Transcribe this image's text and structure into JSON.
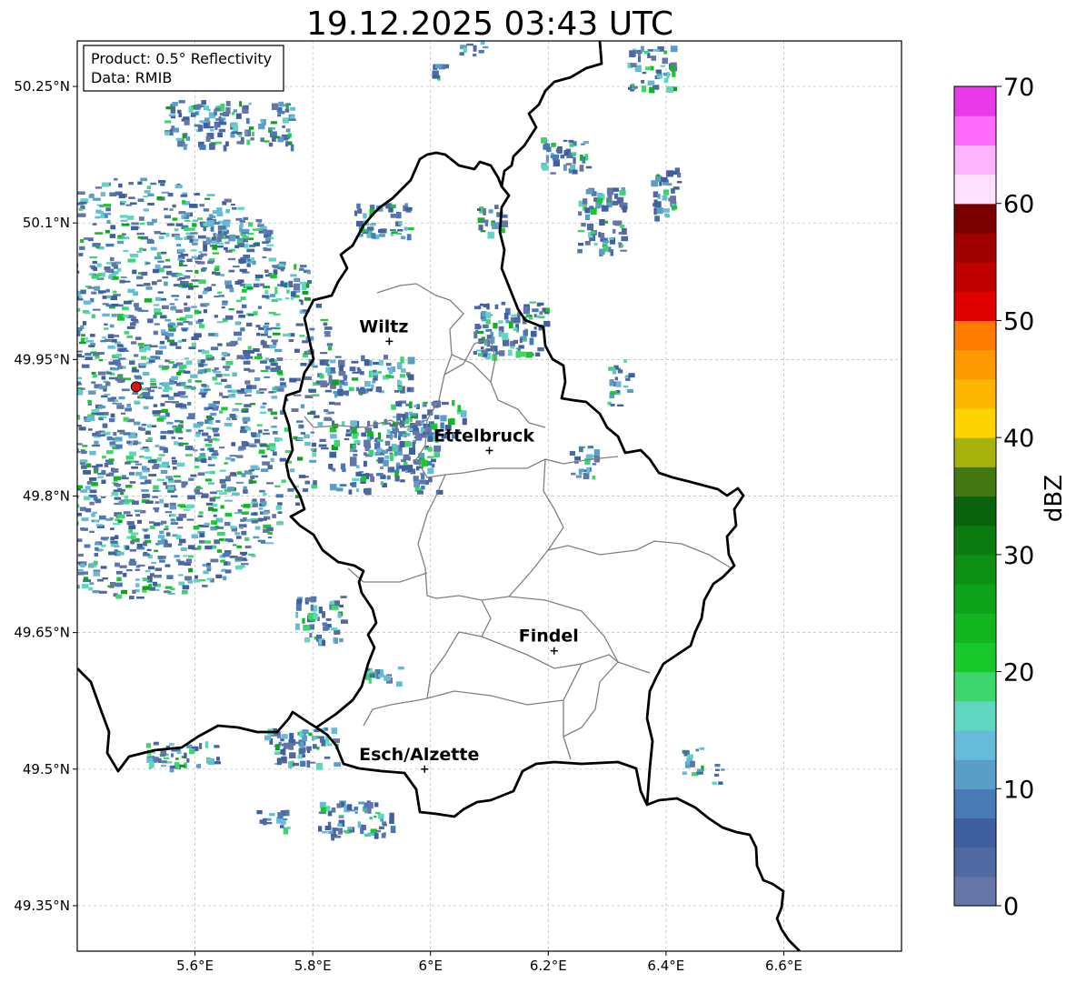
{
  "title": "19.12.2025 03:43 UTC",
  "info_box": {
    "product": "Product: 0.5° Reflectivity",
    "data": "Data: RMIB"
  },
  "axes": {
    "lon_ticks": [
      "5.6°E",
      "5.8°E",
      "6°E",
      "6.2°E",
      "6.4°E",
      "6.6°E"
    ],
    "lat_ticks": [
      "50.25°N",
      "50.1°N",
      "49.95°N",
      "49.8°N",
      "49.65°N",
      "49.5°N",
      "49.35°N"
    ],
    "lon_values": [
      5.6,
      5.8,
      6.0,
      6.2,
      6.4,
      6.6
    ],
    "lat_values": [
      50.25,
      50.1,
      49.95,
      49.8,
      49.65,
      49.5,
      49.35
    ],
    "lon_range": [
      5.4,
      6.8
    ],
    "lat_range": [
      49.3,
      50.3
    ],
    "grid": true
  },
  "cities": [
    {
      "name": "Wiltz",
      "lon": 5.93,
      "lat": 49.97
    },
    {
      "name": "Ettelbruck",
      "lon": 6.1,
      "lat": 49.85
    },
    {
      "name": "Findel",
      "lon": 6.21,
      "lat": 49.63
    },
    {
      "name": "Esch/Alzette",
      "lon": 5.99,
      "lat": 49.5
    }
  ],
  "radar_site": {
    "lon": 5.5,
    "lat": 49.92,
    "color": "#e01010"
  },
  "colorbar": {
    "label": "dBZ",
    "ticks": [
      "0",
      "10",
      "20",
      "30",
      "40",
      "50",
      "60",
      "70"
    ],
    "min": 0,
    "max": 70,
    "colors": [
      "#6575a8",
      "#4f6aa3",
      "#3f5fa0",
      "#4a7ab5",
      "#5a9ec8",
      "#66bcd8",
      "#5fd6c0",
      "#3ed46e",
      "#18c82a",
      "#12b51e",
      "#0ea11a",
      "#0d8f14",
      "#0b7a10",
      "#0a620c",
      "#437712",
      "#a7b20a",
      "#fdd400",
      "#fdb600",
      "#fd9a00",
      "#fd7b00",
      "#e00000",
      "#c00000",
      "#a00000",
      "#7a0000",
      "#fde0fd",
      "#fdb4fd",
      "#fd6cfd",
      "#e83ae8"
    ]
  }
}
